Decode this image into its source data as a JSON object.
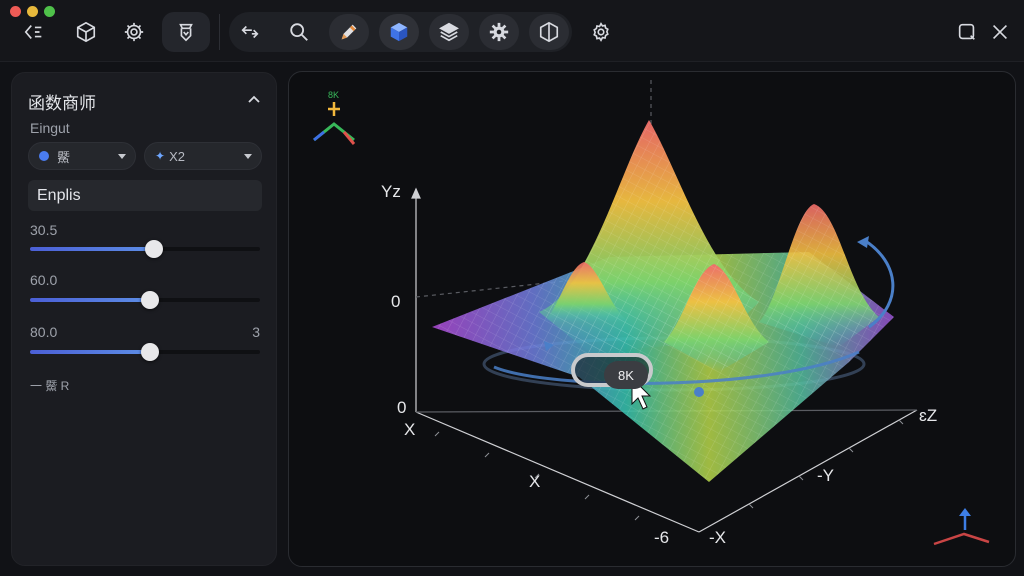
{
  "toolbar": {
    "icons": [
      "back-icon",
      "cube-icon",
      "gear-icon",
      "transform-icon",
      "swap-arrows-icon",
      "search-icon",
      "pencil-icon",
      "solid-cube-icon",
      "layers-icon",
      "cog-icon",
      "hexagon-icon",
      "settings-icon",
      "maximize-icon",
      "close-icon"
    ]
  },
  "panel": {
    "title": "函数商师",
    "section_label": "Eingut",
    "select_left": "鱀",
    "select_right": "X2",
    "field_value": "Enplis",
    "sliders": [
      {
        "label": "30.5",
        "value": 0.54,
        "right_label": ""
      },
      {
        "label": "60.0",
        "value": 0.52,
        "right_label": ""
      },
      {
        "label": "80.0",
        "value": 0.52,
        "right_label": "3"
      }
    ],
    "footer_label": "一 鱀 R"
  },
  "viewport": {
    "axis_labels": {
      "yz": "Yz",
      "zero_upper": "0",
      "zero_lower": "0",
      "x_left": "X",
      "x_front": "X",
      "neg_six": "-6",
      "neg_x": "-X",
      "neg_y": "-Y",
      "ez": "ɛZ"
    },
    "badge_text": "8K",
    "gizmo_text": "8K"
  }
}
